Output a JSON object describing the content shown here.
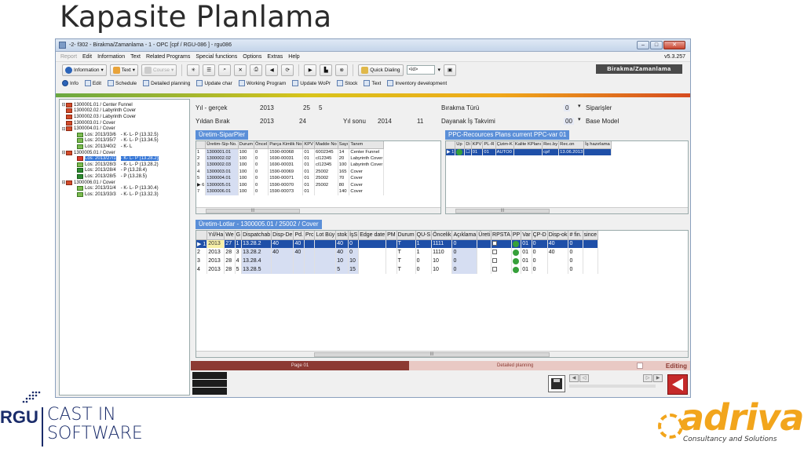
{
  "slide": {
    "title": "Kapasite Planlama"
  },
  "window": {
    "title": "-2- f302 - Birakma/Zamanlama - 1 -    OPC [cpf / RGU-086 ]  -  rgu086",
    "controls": {
      "minimize": "–",
      "maximize": "□",
      "close": "✕"
    }
  },
  "menu": {
    "items": [
      "Report",
      "Edit",
      "Information",
      "Text",
      "Related Programs",
      "Special functions",
      "Options",
      "Extras",
      "Help"
    ],
    "version": "v5.3.257"
  },
  "toolbar": {
    "information_label": "Information",
    "text_label": "Text",
    "course_label": "Course",
    "quick_dialing_label": "Quick Dialing",
    "quick_dialing_value": "<id>",
    "banner": "Birakma/Zamanlama"
  },
  "toolbar2": {
    "items": [
      "Info",
      "Edit",
      "Schedule",
      "Detailed planning",
      "Update char",
      "Working Program",
      "Update WoPr",
      "Stock",
      "Text",
      "Inventory development"
    ]
  },
  "tree": {
    "rows": [
      {
        "exp": "⊟",
        "icon": "order",
        "label": "1300001.01 / Center Funnel",
        "extra": ""
      },
      {
        "exp": "",
        "icon": "order",
        "label": "1300002.02 / Labyrinth Cover",
        "extra": ""
      },
      {
        "exp": "",
        "icon": "order",
        "label": "1300002.03 / Labyrinth Cover",
        "extra": ""
      },
      {
        "exp": "",
        "icon": "order",
        "label": "1300003.01 / Cover",
        "extra": ""
      },
      {
        "exp": "⊟",
        "icon": "order",
        "label": "1300004.01 / Cover",
        "extra": ""
      },
      {
        "exp": "",
        "icon": "lot",
        "label": "Los: 2013/33/6",
        "extra": "- K- L- P (13.32.5)"
      },
      {
        "exp": "",
        "icon": "lot",
        "label": "Los: 2013/35/7",
        "extra": "- K- L- P (13.34.5)"
      },
      {
        "exp": "",
        "icon": "lot",
        "label": "Los: 2013/40/2",
        "extra": "- K- L"
      },
      {
        "exp": "⊟",
        "icon": "order",
        "label": "1300005.01 / Cover",
        "extra": ""
      },
      {
        "exp": "",
        "icon": "lot-red",
        "label": "Los: 2013/27/1",
        "extra": "- K- L- P (13.28.2)",
        "selected": true
      },
      {
        "exp": "",
        "icon": "lot",
        "label": "Los: 2013/28/3",
        "extra": "- K- L- P (13.28.2)"
      },
      {
        "exp": "",
        "icon": "lot-green",
        "label": "Los: 2013/28/4",
        "extra": "- P (13.28.4)"
      },
      {
        "exp": "",
        "icon": "lot-green",
        "label": "Los: 2013/28/5",
        "extra": "- P (13.28.5)"
      },
      {
        "exp": "⊟",
        "icon": "order",
        "label": "1300006.01 / Cover",
        "extra": ""
      },
      {
        "exp": "",
        "icon": "lot",
        "label": "Los: 2013/31/4",
        "extra": "- K- L- P (13.30.4)"
      },
      {
        "exp": "",
        "icon": "lot",
        "label": "Los: 2013/33/3",
        "extra": "- K- L- P (13.32.3)"
      }
    ]
  },
  "form": {
    "yil_gercek_label": "Yıl - gerçek",
    "yil_gercek_year": "2013",
    "yil_gercek_week": "25",
    "yil_gercek_day": "5",
    "yildan_birak_label": "Yıldan Bırak",
    "yildan_birak_year": "2013",
    "yildan_birak_week": "24",
    "yil_sonu_label": "Yıl sonu",
    "yil_sonu_year": "2014",
    "yil_sonu_week": "11",
    "birakma_turu_label": "Bırakma Türü",
    "birakma_turu_value": "0",
    "birakma_turu_text": "Siparişler",
    "dayanak_label": "Dayanak İş Takvimi",
    "dayanak_value": "00",
    "dayanak_text": "Base Model"
  },
  "orders_panel": {
    "title": "Üretim-SiparPler",
    "headers": [
      "",
      "Üretim-Sip-No.",
      "Durum",
      "Öncel",
      "Parça Kimlik No",
      "KPV",
      "Madde No",
      "Sayı",
      "Tanım"
    ],
    "rows": [
      [
        "1",
        "1300001.01",
        "100",
        "0",
        "1590-00068",
        "01",
        "6002345",
        "14",
        "Center Funnel"
      ],
      [
        "2",
        "1300002.02",
        "100",
        "0",
        "1690-00031",
        "01",
        "cl12345",
        "20",
        "Labyrinth Cover"
      ],
      [
        "3",
        "1300002.03",
        "100",
        "0",
        "1690-00031",
        "01",
        "cl12345",
        "100",
        "Labyrinth Cover"
      ],
      [
        "4",
        "1300003.01",
        "100",
        "0",
        "1590-00069",
        "01",
        "25002",
        "165",
        "Cover"
      ],
      [
        "5",
        "1300004.01",
        "100",
        "0",
        "1590-00071",
        "01",
        "25002",
        "70",
        "Cover"
      ],
      [
        "▶ 6",
        "1300005.01",
        "100",
        "0",
        "1590-00070",
        "01",
        "25002",
        "80",
        "Cover"
      ],
      [
        "7",
        "1300006.01",
        "100",
        "0",
        "1590-00073",
        "01",
        "",
        "140",
        "Cover"
      ]
    ],
    "scroll_label": "III"
  },
  "ppc_panel": {
    "title": "PPC-Recources Plans current PPC-var 01",
    "headers": [
      "",
      "Up",
      "Di",
      "KPV",
      "PL-R",
      "Çizim-K",
      "Kalite KPlanı",
      "Rec.by",
      "Rec.on",
      "İş hazırlama"
    ],
    "rows": [
      [
        "▶ 1",
        "●",
        "☐",
        "01",
        "01",
        "AUTO0",
        "",
        "cpf",
        "13.06.2013",
        ""
      ]
    ],
    "scroll_label": "III"
  },
  "lots_panel": {
    "title": "Üretim-Lotlar  - 1300005.01 / 25002 / Cover",
    "headers": [
      "",
      "Yıl/Ha",
      "We",
      "G",
      "Dispatchab",
      "Disp-De",
      "Pd.",
      "Prc",
      "Lot Büy",
      "stok",
      "İşS",
      "Edge date",
      "PM",
      "Durum",
      "QU-S",
      "Öncelik",
      "Açıklama",
      "Üreti",
      "RPSTA",
      "PP",
      "Var",
      "ÇP-D",
      "Disp-ok",
      "# fin.",
      "since"
    ],
    "rows": [
      [
        "▶ 1",
        "2013",
        "27",
        "1",
        "13.28.2",
        "40",
        "40",
        "",
        "",
        "40",
        "0",
        "",
        "",
        "T",
        "1",
        "1111",
        "0",
        "",
        "☐",
        "●",
        "01",
        "0",
        "40",
        "0",
        ""
      ],
      [
        "2",
        "2013",
        "28",
        "3",
        "13.28.2",
        "40",
        "40",
        "",
        "",
        "40",
        "0",
        "",
        "",
        "T",
        "1",
        "1110",
        "0",
        "",
        "☐",
        "●",
        "01",
        "0",
        "40",
        "0",
        ""
      ],
      [
        "3",
        "2013",
        "28",
        "4",
        "13.28.4",
        "",
        "",
        "",
        "",
        "10",
        "10",
        "",
        "",
        "T",
        "0",
        "10",
        "0",
        "",
        "☐",
        "●",
        "01",
        "0",
        "",
        "0",
        ""
      ],
      [
        "4",
        "2013",
        "28",
        "5",
        "13.28.5",
        "",
        "",
        "",
        "",
        "5",
        "15",
        "",
        "",
        "T",
        "0",
        "10",
        "0",
        "",
        "☐",
        "●",
        "01",
        "0",
        "",
        "0",
        ""
      ]
    ],
    "scroll_label": "III"
  },
  "status": {
    "page": "Page 01",
    "mode": "Detailed planning",
    "editing": "Editing"
  },
  "footer": {
    "rgu": "RGU",
    "cast_line1": "CAST IN",
    "cast_line2": "SOFTWARE",
    "adriva": "adriva",
    "adriva_tagline": "Consultancy and Solutions"
  },
  "colors": {
    "accent_blue": "#5b8fd8",
    "selection_blue": "#1e4fa8",
    "status_red": "#8c3a33",
    "adriva_orange": "#f2a51c",
    "rgu_navy": "#1a2c6a"
  }
}
